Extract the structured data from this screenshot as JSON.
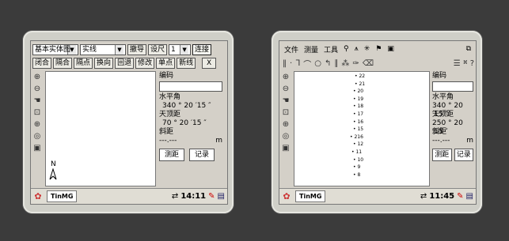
{
  "left_window": {
    "toolbar1": {
      "layer_select": "基本实体图",
      "linetype_select": "实线",
      "btn_capture": "撤导",
      "btn_set_ruler": "设尺",
      "num_select": "1",
      "btn_connect": "连接"
    },
    "toolbar2": {
      "btn_close": "闭合",
      "btn_sep_join": "隔合",
      "btn_sep_point": "隔点",
      "btn_reverse": "换向",
      "btn_undo": "回退",
      "btn_modify": "修改",
      "btn_single_point": "单点",
      "btn_new_line": "新线",
      "btn_x": "X"
    },
    "north_label": "N",
    "info": {
      "code_label": "编码",
      "hangle_label": "水平角",
      "hangle_value": "340 ° 20 ′15 ″",
      "zenith_label": "天顶距",
      "zenith_value": "70 ° 20 ′15 ″",
      "slope_label": "斜距",
      "slope_value": "---.---",
      "slope_unit": "m",
      "btn_measure": "测距",
      "btn_record": "记录"
    },
    "taskbar": {
      "app": "TinMG",
      "time": "14:11"
    }
  },
  "right_window": {
    "menu": [
      "文件",
      "测量",
      "工具"
    ],
    "info": {
      "code_label": "编码",
      "hangle_label": "水平角",
      "hangle_value": "340 ° 20 ′15 ″",
      "zenith_label": "天顶距",
      "zenith_value": "250 ° 20 ′15 ″",
      "slope_label": "斜距",
      "slope_value": "---.---",
      "slope_unit": "m",
      "btn_measure": "测距",
      "btn_record": "记录"
    },
    "points": [
      "22",
      "21",
      "20",
      "19",
      "18",
      "17",
      "16",
      "15",
      "216",
      "12",
      "11",
      "10",
      "9",
      "8"
    ],
    "taskbar": {
      "app": "TinMG",
      "time": "11:45"
    }
  }
}
